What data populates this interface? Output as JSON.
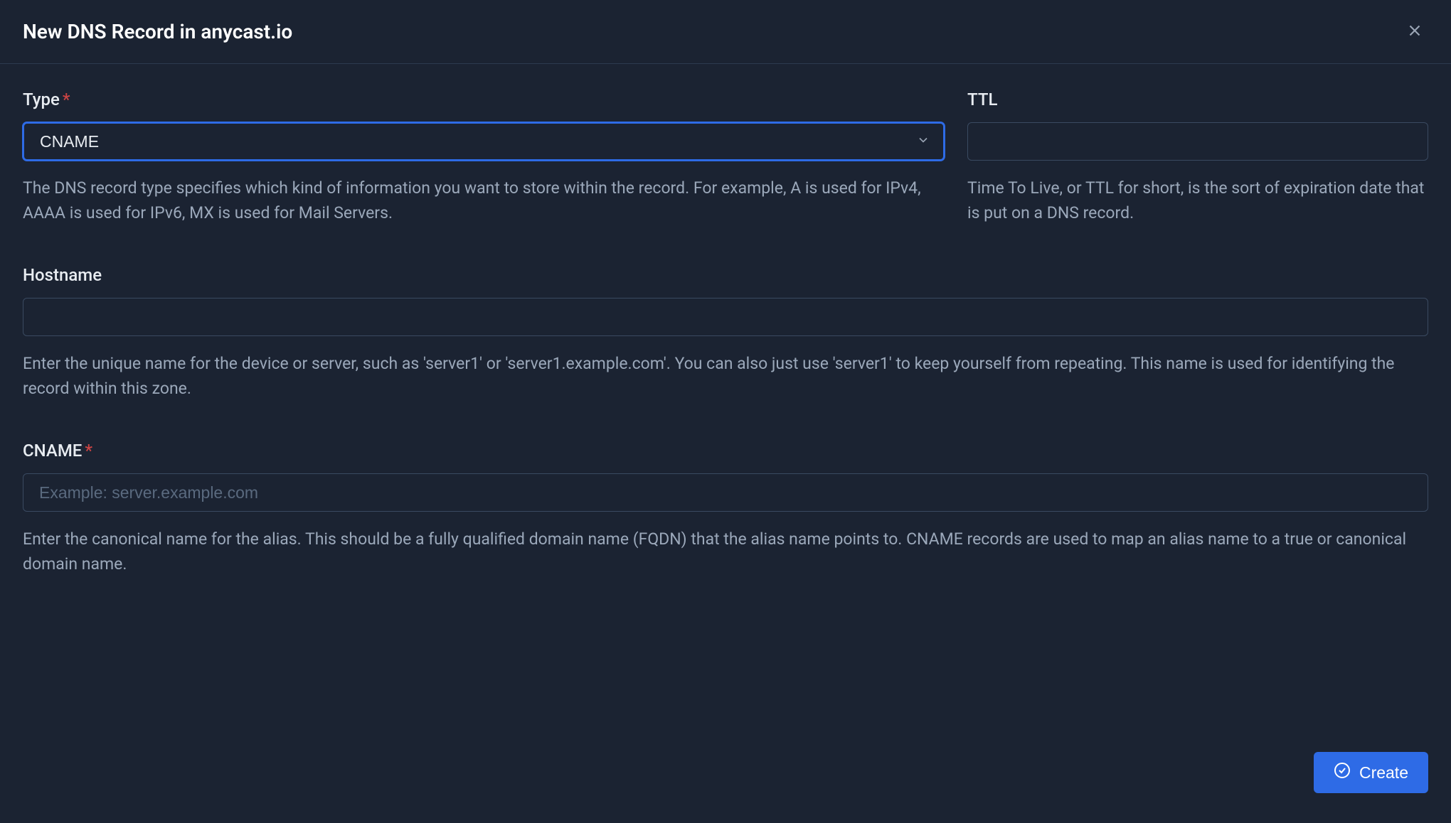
{
  "modal": {
    "title": "New DNS Record in anycast.io"
  },
  "form": {
    "type": {
      "label": "Type",
      "value": "CNAME",
      "help": "The DNS record type specifies which kind of information you want to store within the record. For example, A is used for IPv4, AAAA is used for IPv6, MX is used for Mail Servers."
    },
    "ttl": {
      "label": "TTL",
      "value": "",
      "help": "Time To Live, or TTL for short, is the sort of expiration date that is put on a DNS record."
    },
    "hostname": {
      "label": "Hostname",
      "value": "",
      "help": "Enter the unique name for the device or server, such as 'server1' or 'server1.example.com'. You can also just use 'server1' to keep yourself from repeating. This name is used for identifying the record within this zone."
    },
    "cname": {
      "label": "CNAME",
      "value": "",
      "placeholder": "Example: server.example.com",
      "help": "Enter the canonical name for the alias. This should be a fully qualified domain name (FQDN) that the alias name points to. CNAME records are used to map an alias name to a true or canonical domain name."
    }
  },
  "buttons": {
    "create": "Create"
  }
}
